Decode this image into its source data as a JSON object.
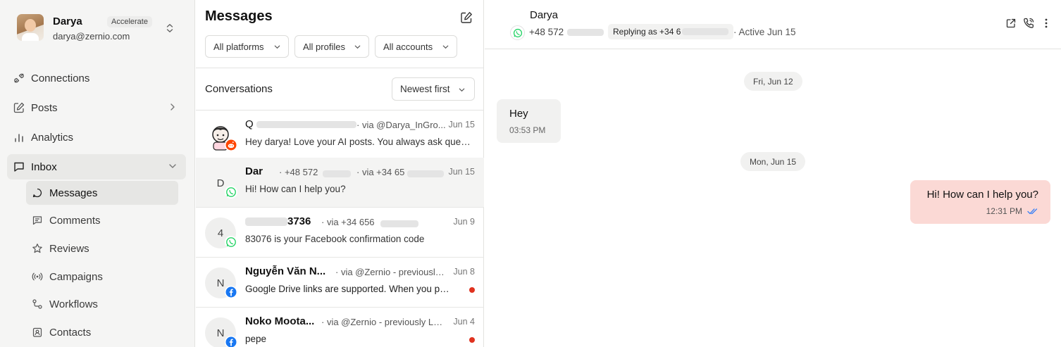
{
  "sidebar": {
    "profile": {
      "name": "Darya",
      "plan": "Accelerate",
      "email": "darya@zernio.com"
    },
    "nav": [
      {
        "label": "Connections",
        "icon": "plug-icon"
      },
      {
        "label": "Posts",
        "icon": "edit-icon"
      },
      {
        "label": "Analytics",
        "icon": "bar-chart-icon"
      },
      {
        "label": "Inbox",
        "icon": "inbox-icon",
        "active": true
      }
    ],
    "inbox_sub": [
      {
        "label": "Messages",
        "icon": "message-circle-icon",
        "active": true
      },
      {
        "label": "Comments",
        "icon": "comment-square-icon"
      },
      {
        "label": "Reviews",
        "icon": "star-icon"
      },
      {
        "label": "Campaigns",
        "icon": "broadcast-icon"
      },
      {
        "label": "Workflows",
        "icon": "workflow-icon"
      },
      {
        "label": "Contacts",
        "icon": "contact-card-icon"
      }
    ]
  },
  "messages": {
    "title": "Messages",
    "filters": [
      "All platforms",
      "All profiles",
      "All accounts"
    ],
    "conversations_label": "Conversations",
    "sort_label": "Newest first",
    "conversations": [
      {
        "name": "Q",
        "via": "· via @Darya_InGro...",
        "date": "Jun 15",
        "preview": "Hey darya! Love your AI posts. You always ask questi...",
        "platform": "reddit",
        "avatar": ""
      },
      {
        "name": "Dar",
        "phone": "· +48 572",
        "via": "· via +34 65",
        "date": "Jun 15",
        "preview": "Hi! How can I help you?",
        "platform": "whatsapp",
        "avatar": "D"
      },
      {
        "name": "3736",
        "via": "· via +34 656",
        "date": "Jun 9",
        "preview": "83076 is your Facebook confirmation code",
        "platform": "whatsapp",
        "avatar": "4"
      },
      {
        "name": "Nguyễn Văn N...",
        "via": "· via @Zernio - previously...",
        "date": "Jun 8",
        "preview": "Google Drive links are supported. When you pass ...",
        "platform": "facebook",
        "avatar": "N",
        "unread": true
      },
      {
        "name": "Noko Moota...",
        "via": "· via @Zernio - previously La...",
        "date": "Jun 4",
        "preview": "pepe",
        "platform": "facebook",
        "avatar": "N",
        "unread": true
      }
    ]
  },
  "chat": {
    "contact_name": "Darya",
    "phone": "+48 572",
    "replying_as": "Replying as +34 6",
    "active": "· Active Jun 15",
    "date_separators": [
      "Fri, Jun 12",
      "Mon, Jun 15"
    ],
    "messages": [
      {
        "direction": "in",
        "text": "Hey",
        "time": "03:53 PM"
      },
      {
        "direction": "out",
        "text": "Hi! How can I help you?",
        "time": "12:31 PM"
      }
    ]
  },
  "colors": {
    "accent_bubble": "#fbd9d5",
    "whatsapp": "#25d366",
    "facebook": "#1877f2",
    "reddit": "#ff4500",
    "unread": "#e0321f"
  }
}
